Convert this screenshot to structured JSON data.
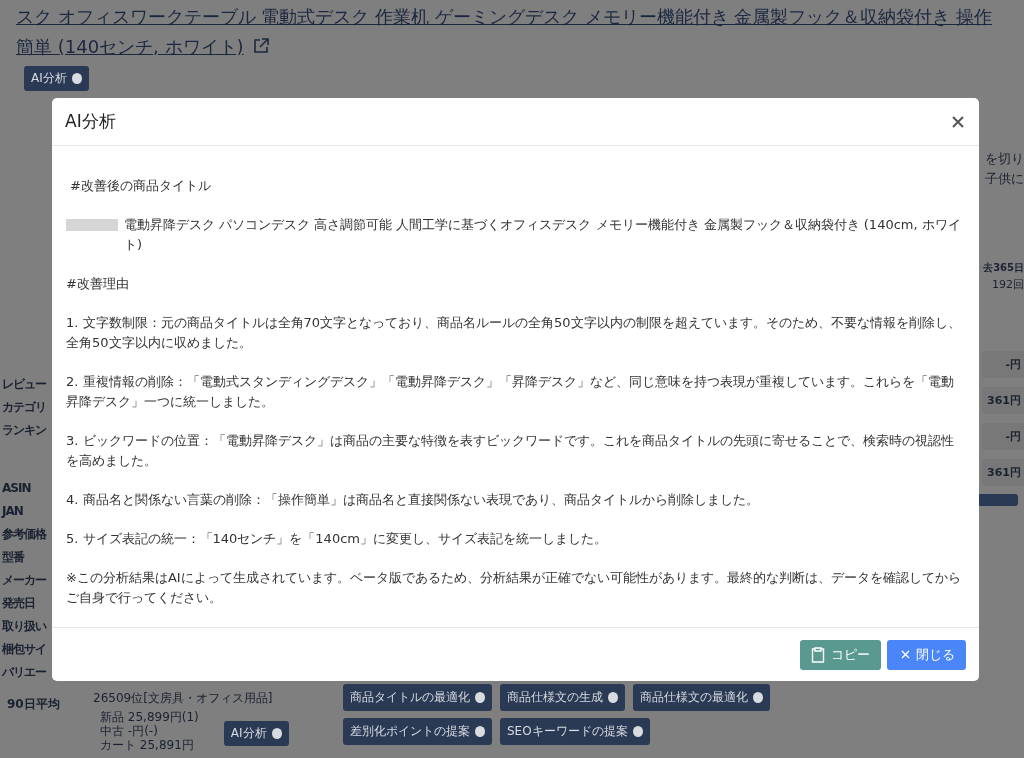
{
  "page": {
    "product_title": "スク オフィスワークテーブル 電動式デスク 作業机 ゲーミングデスク メモリー機能付き 金属製フック＆収納袋付き 操作簡単 (140センチ, ホワイト)",
    "ai_button": "AI分析",
    "left_labels": [
      "レビュー",
      "カテゴリ",
      "ランキン",
      "ASIN",
      "JAN",
      "参考価格",
      "型番",
      "メーカー",
      "発売日",
      "取り扱い",
      "梱包サイ",
      "バリエー"
    ],
    "right_texts": [
      {
        "kind": "plain",
        "text": "を切り"
      },
      {
        "kind": "plain",
        "text": "子供に"
      },
      {
        "kind": "bold",
        "text": "去365日"
      },
      {
        "kind": "plain",
        "text": "192回"
      },
      {
        "kind": "price",
        "text": "-円"
      },
      {
        "kind": "price",
        "text": "361円"
      },
      {
        "kind": "price",
        "text": "-円"
      },
      {
        "kind": "price",
        "text": "361円"
      }
    ],
    "average_label": "90日平均",
    "ranking": "26509位[文房具・オフィス用品]",
    "prices": [
      "新品 25,899円(1)",
      "中古 -円(-)",
      "カート 25,891円"
    ],
    "ai_button_2": "AI分析",
    "prompt_buttons": [
      "商品タイトルの最適化",
      "商品仕様文の生成",
      "商品仕様文の最適化",
      "差別化ポイントの提案",
      "SEOキーワードの提案"
    ]
  },
  "modal": {
    "title": "AI分析",
    "paragraphs": [
      {
        "kind": "heading",
        "text": "#改善後の商品タイトル"
      },
      {
        "kind": "redacted",
        "text": "電動昇降デスク パソコンデスク 高さ調節可能 人間工学に基づくオフィスデスク メモリー機能付き 金属製フック＆収納袋付き (140cm, ホワイト)"
      },
      {
        "kind": "text",
        "text": "#改善理由"
      },
      {
        "kind": "text",
        "text": "1. 文字数制限：元の商品タイトルは全角70文字となっており、商品名ルールの全角50文字以内の制限を超えています。そのため、不要な情報を削除し、全角50文字以内に収めました。"
      },
      {
        "kind": "text",
        "text": "2. 重複情報の削除：「電動式スタンディングデスク」「電動昇降デスク」「昇降デスク」など、同じ意味を持つ表現が重複しています。これらを「電動昇降デスク」一つに統一しました。"
      },
      {
        "kind": "text",
        "text": "3. ビックワードの位置：「電動昇降デスク」は商品の主要な特徴を表すビックワードです。これを商品タイトルの先頭に寄せることで、検索時の視認性を高めました。"
      },
      {
        "kind": "text",
        "text": "4. 商品名と関係ない言葉の削除：「操作簡単」は商品名と直接関係ない表現であり、商品タイトルから削除しました。"
      },
      {
        "kind": "text",
        "text": "5. サイズ表記の統一：「140センチ」を「140cm」に変更し、サイズ表記を統一しました。"
      },
      {
        "kind": "text",
        "text": "※この分析結果はAIによって生成されています。ベータ版であるため、分析結果が正確でない可能性があります。最終的な判断は、データを確認してからご自身で行ってください。"
      }
    ],
    "copy_button": "コピー",
    "close_button": "閉じる"
  }
}
